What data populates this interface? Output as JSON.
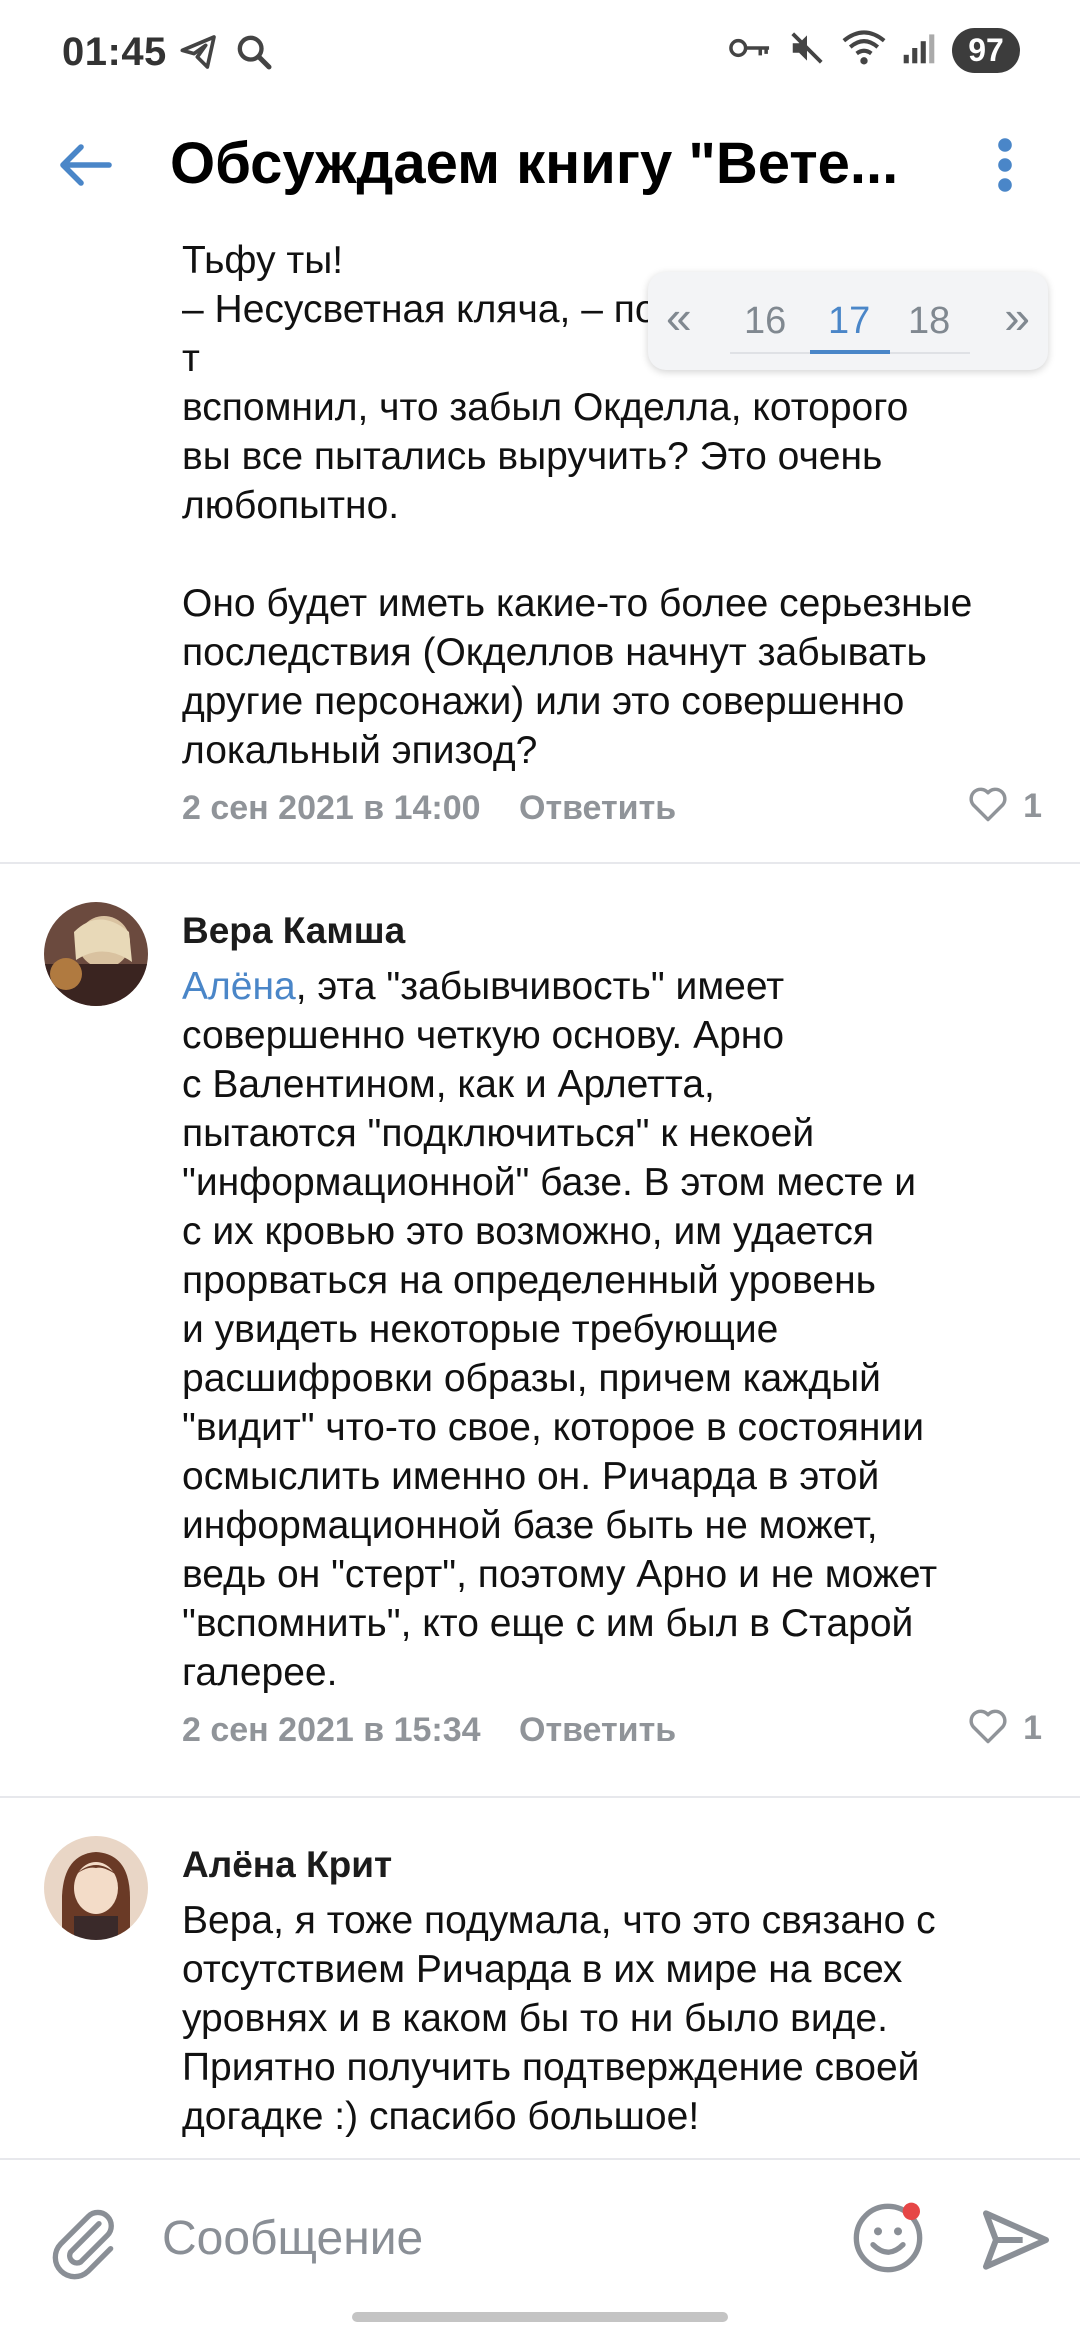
{
  "status_bar": {
    "time": "01:45",
    "battery": "97",
    "left_icons": [
      "telegram-icon",
      "search-icon"
    ],
    "right_icons": [
      "vpn-key-icon",
      "mute-icon",
      "wifi-icon",
      "signal-icon"
    ]
  },
  "header": {
    "title": "Обсуждаем книгу \"Вете..."
  },
  "pager": {
    "first": "«",
    "pages": [
      "16",
      "17",
      "18"
    ],
    "active": "17",
    "last": "»"
  },
  "comments": [
    {
      "text": "Тьфу ты!\n– Несусветная кляча, – подсказал Спрут. – Ты т\nвспомнил, что забыл Окделла, которого\nвы все пытались выручить? Это очень\nлюбопытно.\n\nОно будет иметь какие-то более серьезные\nпоследствия (Окделлов начнут забывать\nдругие персонажи) или это совершенно\nлокальный эпизод?",
      "date": "2 сен 2021 в 14:00",
      "reply": "Ответить",
      "likes": "1"
    },
    {
      "author": "Вера Камша",
      "mention": "Алёна",
      "text": ", эта \"забывчивость\" имеет\nсовершенно четкую основу. Арно\nс Валентином, как и Арлетта,\nпытаются \"подключиться\" к некоей\n\"информационной\" базе. В этом месте и\nс их кровью это возможно, им удается\nпрорваться на определенный уровень\nи увидеть некоторые требующие\nрасшифровки образы, причем каждый\n\"видит\" что-то свое, которое в состоянии\nосмыслить именно он. Ричарда в этой\nинформационной базе быть не может,\nведь он \"стерт\", поэтому Арно и не может\n\"вспомнить\", кто еще с им был в Старой\nгалерее.",
      "date": "2 сен 2021 в 15:34",
      "reply": "Ответить",
      "likes": "1"
    },
    {
      "author": "Алёна Крит",
      "text": "Вера, я тоже подумала, что это связано с\nотсутствием Ричарда в их мире на всех\nуровнях и в каком бы то ни было виде.\nПриятно получить подтверждение своей\nдогадке :) спасибо большое!"
    }
  ],
  "compose": {
    "placeholder": "Сообщение"
  },
  "colors": {
    "accent": "#4a86c8",
    "muted": "#909499",
    "divider": "#e7e8ec",
    "notification_dot": "#e64646"
  }
}
